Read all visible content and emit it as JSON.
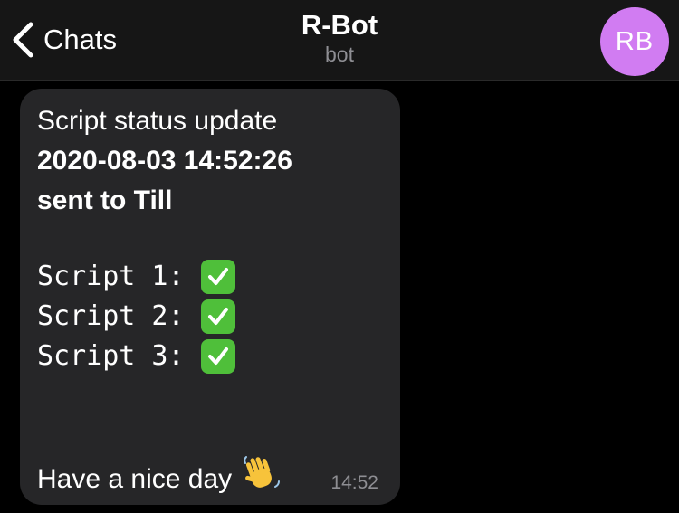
{
  "header": {
    "back_label": "Chats",
    "title": "R-Bot",
    "subtitle": "bot",
    "avatar_initials": "RB",
    "avatar_color": "#d17cf2"
  },
  "message": {
    "heading": "Script status update",
    "bold_line1": "2020-08-03 14:52:26",
    "bold_line2": "sent to Till",
    "scripts": [
      {
        "label": "Script 1:",
        "status_icon": "check-mark-icon"
      },
      {
        "label": "Script 2:",
        "status_icon": "check-mark-icon"
      },
      {
        "label": "Script 3:",
        "status_icon": "check-mark-icon"
      }
    ],
    "closing": "Have a nice day",
    "closing_icon": "waving-hand-icon",
    "time": "14:52"
  },
  "colors": {
    "background": "#000000",
    "header": "#161616",
    "bubble": "#262628",
    "check": "#4fbf3a",
    "muted_text": "#8e8e93"
  }
}
